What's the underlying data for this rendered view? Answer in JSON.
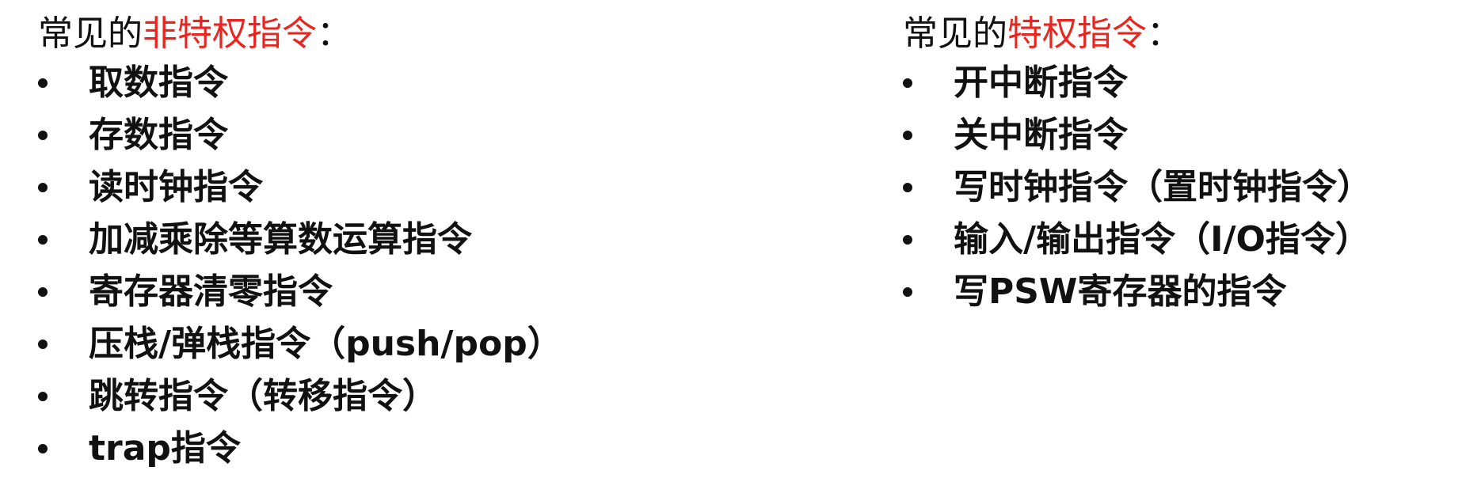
{
  "left": {
    "heading_prefix": "常见的",
    "heading_accent": "非特权指令",
    "heading_suffix": "：",
    "items": [
      "取数指令",
      "存数指令",
      "读时钟指令",
      "加减乘除等算数运算指令",
      "寄存器清零指令",
      "压栈/弹栈指令（push/pop）",
      "跳转指令（转移指令）",
      "trap指令"
    ]
  },
  "right": {
    "heading_prefix": "常见的",
    "heading_accent": "特权指令",
    "heading_suffix": "：",
    "items": [
      "开中断指令",
      "关中断指令",
      "写时钟指令（置时钟指令）",
      "输入/输出指令（I/O指令）",
      "写PSW寄存器的指令"
    ]
  },
  "colors": {
    "accent": "#e8251f",
    "text": "#111111",
    "background": "#ffffff"
  }
}
